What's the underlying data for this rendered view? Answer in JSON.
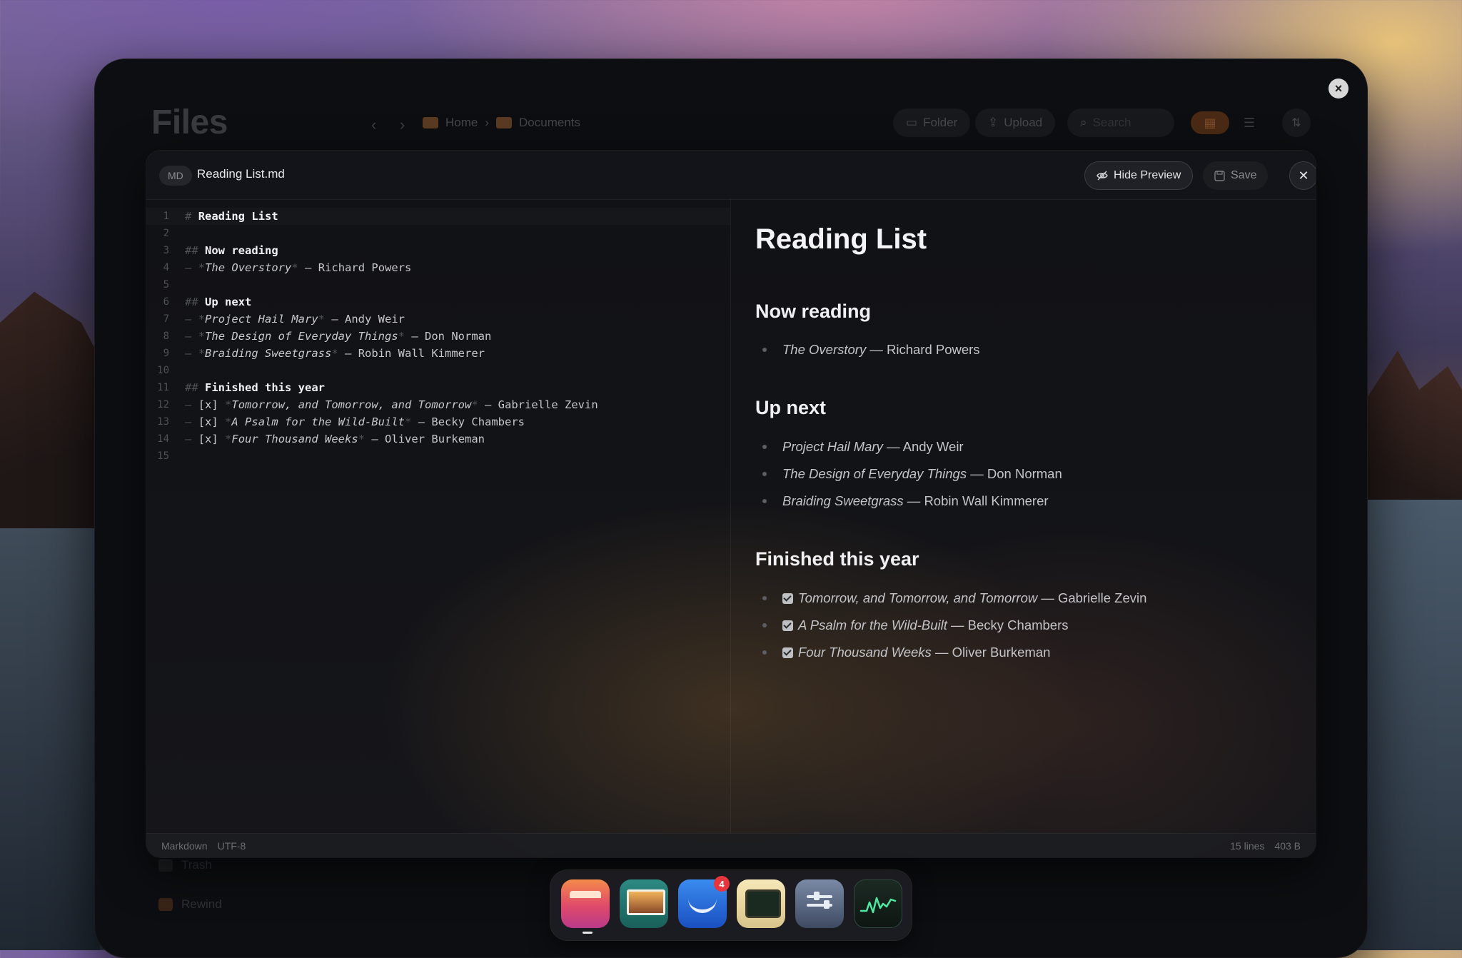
{
  "files_app": {
    "title": "Files",
    "breadcrumb": [
      "Home",
      "Documents"
    ],
    "toolbar": {
      "folder_label": "Folder",
      "upload_label": "Upload",
      "search_placeholder": "Search"
    },
    "sidebar": {
      "trash_label": "Trash",
      "rewind_label": "Rewind"
    }
  },
  "editor": {
    "type_badge": "MD",
    "file_name": "Reading List.md",
    "hide_preview_label": "Hide Preview",
    "save_label": "Save",
    "code_lines": {
      "l1": {
        "marker": "#",
        "text": "Reading List"
      },
      "l3": {
        "marker": "##",
        "text": "Now reading"
      },
      "l4": {
        "dash": "–",
        "star_open": "*",
        "title": "The Overstory",
        "star_close": "*",
        "author": "— Richard Powers"
      },
      "l6": {
        "marker": "##",
        "text": "Up next"
      },
      "l7": {
        "dash": "–",
        "star_open": "*",
        "title": "Project Hail Mary",
        "star_close": "*",
        "author": "— Andy Weir"
      },
      "l8": {
        "dash": "–",
        "star_open": "*",
        "title": "The Design of Everyday Things",
        "star_close": "*",
        "author": "— Don Norman"
      },
      "l9": {
        "dash": "–",
        "star_open": "*",
        "title": "Braiding Sweetgrass",
        "star_close": "*",
        "author": "— Robin Wall Kimmerer"
      },
      "l11": {
        "marker": "##",
        "text": "Finished this year"
      },
      "l12": {
        "dash": "–",
        "check": "[x]",
        "star_open": "*",
        "title": "Tomorrow, and Tomorrow, and Tomorrow",
        "star_close": "*",
        "author": "— Gabrielle Zevin"
      },
      "l13": {
        "dash": "–",
        "check": "[x]",
        "star_open": "*",
        "title": "A Psalm for the Wild-Built",
        "star_close": "*",
        "author": "— Becky Chambers"
      },
      "l14": {
        "dash": "–",
        "check": "[x]",
        "star_open": "*",
        "title": "Four Thousand Weeks",
        "star_close": "*",
        "author": "— Oliver Burkeman"
      }
    },
    "line_numbers": [
      "1",
      "2",
      "3",
      "4",
      "5",
      "6",
      "7",
      "8",
      "9",
      "10",
      "11",
      "12",
      "13",
      "14",
      "15"
    ],
    "preview": {
      "h1": "Reading List",
      "sections": [
        {
          "heading": "Now reading",
          "items": [
            {
              "title": "The Overstory",
              "author": " — Richard Powers"
            }
          ]
        },
        {
          "heading": "Up next",
          "items": [
            {
              "title": "Project Hail Mary",
              "author": " — Andy Weir"
            },
            {
              "title": "The Design of Everyday Things",
              "author": " — Don Norman"
            },
            {
              "title": "Braiding Sweetgrass",
              "author": " — Robin Wall Kimmerer"
            }
          ]
        },
        {
          "heading": "Finished this year",
          "items": [
            {
              "title": "Tomorrow, and Tomorrow, and Tomorrow",
              "author": " — Gabrielle Zevin",
              "checked": true
            },
            {
              "title": "A Psalm for the Wild-Built",
              "author": " — Becky Chambers",
              "checked": true
            },
            {
              "title": "Four Thousand Weeks",
              "author": " — Oliver Burkeman",
              "checked": true
            }
          ]
        }
      ]
    },
    "status": {
      "language": "Markdown",
      "encoding": "UTF-8",
      "lines": "15 lines",
      "size": "403 B"
    }
  },
  "dock": {
    "mail_badge": "4",
    "apps": [
      "files-app-icon",
      "photos-app-icon",
      "mail-app-icon",
      "terminal-app-icon",
      "settings-app-icon",
      "activity-monitor-app-icon"
    ]
  },
  "colors": {
    "editor_bg": "#121317",
    "heading_text": "#f2f2f4",
    "markdown_marker": "#4f5157",
    "badge_red": "#e8343c"
  }
}
